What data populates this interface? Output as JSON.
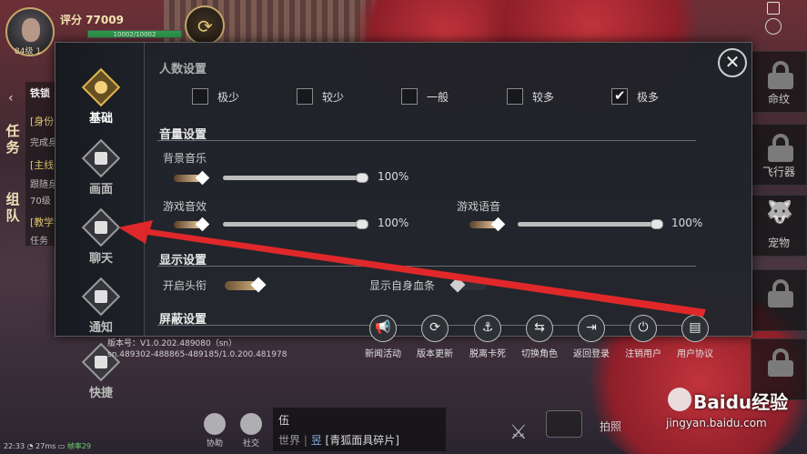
{
  "hud": {
    "score": "评分 77009",
    "hp_text": "10002/10002",
    "level": "84级 1",
    "time": "22:33",
    "ping": "27ms",
    "fps": "帧率29"
  },
  "side_strip": {
    "tab1": "任务",
    "tab2": "组队",
    "quest_header": "铁锁",
    "q1": "[身份",
    "q2": "完成身",
    "q3": "[主线",
    "q4": "跟随身",
    "q5": "70级",
    "q6": "[教学",
    "q7": "任务"
  },
  "right_slots": [
    {
      "label": "命纹"
    },
    {
      "label": "飞行器"
    },
    {
      "label": "宠物"
    },
    {
      "label": ""
    },
    {
      "label": ""
    }
  ],
  "bottom_hud": {
    "btn1": "协助",
    "btn2": "社交",
    "chat_line1": "伍",
    "chat_channel": "世界",
    "chat_sender": "昱",
    "chat_msg": "[青狐面具碎片]",
    "photo_label": "拍照"
  },
  "panel": {
    "nav": [
      {
        "label": "基础",
        "active": true
      },
      {
        "label": "画面"
      },
      {
        "label": "聊天"
      },
      {
        "label": "通知"
      },
      {
        "label": "快捷"
      }
    ],
    "close_icon": "close-icon",
    "people": {
      "title": "人数设置",
      "options": [
        {
          "label": "极少",
          "checked": false
        },
        {
          "label": "较少",
          "checked": false
        },
        {
          "label": "一般",
          "checked": false
        },
        {
          "label": "较多",
          "checked": false
        },
        {
          "label": "极多",
          "checked": true
        }
      ]
    },
    "volume": {
      "title": "音量设置",
      "bgm_label": "背景音乐",
      "bgm_value": "100%",
      "sfx_label": "游戏音效",
      "sfx_value": "100%",
      "voice_label": "游戏语音",
      "voice_value": "100%"
    },
    "display": {
      "title": "显示设置",
      "title_toggle_label": "开启头衔",
      "title_toggle_on": true,
      "hpbar_toggle_label": "显示自身血条",
      "hpbar_toggle_on": false
    },
    "block": {
      "title": "屏蔽设置"
    },
    "version_line1": "版本号：V1.0.202.489080（sn）",
    "version_line2": "sn.489302-488865-489185/1.0.200.481978",
    "actions": [
      {
        "label": "新闻活动",
        "icon": "megaphone-icon"
      },
      {
        "label": "版本更新",
        "icon": "refresh-icon"
      },
      {
        "label": "脱离卡死",
        "icon": "anchor-icon"
      },
      {
        "label": "切换角色",
        "icon": "switch-role-icon"
      },
      {
        "label": "返回登录",
        "icon": "logout-icon"
      },
      {
        "label": "注销用户",
        "icon": "power-icon"
      },
      {
        "label": "用户协议",
        "icon": "document-icon"
      }
    ]
  },
  "watermark": {
    "main": "Baidu经验",
    "url": "jingyan.baidu.com"
  },
  "colors": {
    "annotation_arrow": "#e0282a",
    "accent_gold": "#e0b64e"
  }
}
